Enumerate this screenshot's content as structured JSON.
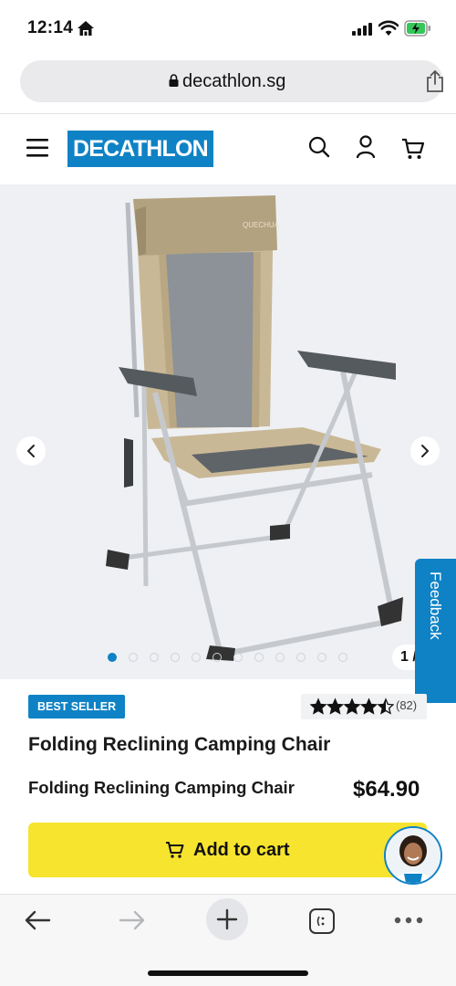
{
  "status": {
    "time": "12:14"
  },
  "browser": {
    "url": "decathlon.sg"
  },
  "header": {
    "logo_text": "DECATHLON"
  },
  "gallery": {
    "image_brand_text": "QUECHUA",
    "dot_count": 12,
    "active_index": 0,
    "counter": "1 /",
    "feedback_label": "Feedback"
  },
  "product": {
    "badge": "BEST SELLER",
    "rating_stars": 4.5,
    "rating_count": "(82)",
    "title": "Folding Reclining Camping Chair",
    "subtitle": "Folding Reclining Camping Chair",
    "price": "$64.90",
    "add_to_cart": "Add to cart"
  },
  "colors": {
    "brand_blue": "#0f82c5",
    "cta_yellow": "#f7e42e"
  },
  "icons": [
    "home-icon",
    "signal-icon",
    "wifi-icon",
    "battery-charging-icon",
    "lock-icon",
    "share-icon",
    "menu-icon",
    "search-icon",
    "account-icon",
    "cart-icon",
    "chevron-left-icon",
    "chevron-right-icon",
    "star-icon",
    "back-icon",
    "forward-icon",
    "new-tab-icon",
    "tabs-icon",
    "more-icon"
  ]
}
